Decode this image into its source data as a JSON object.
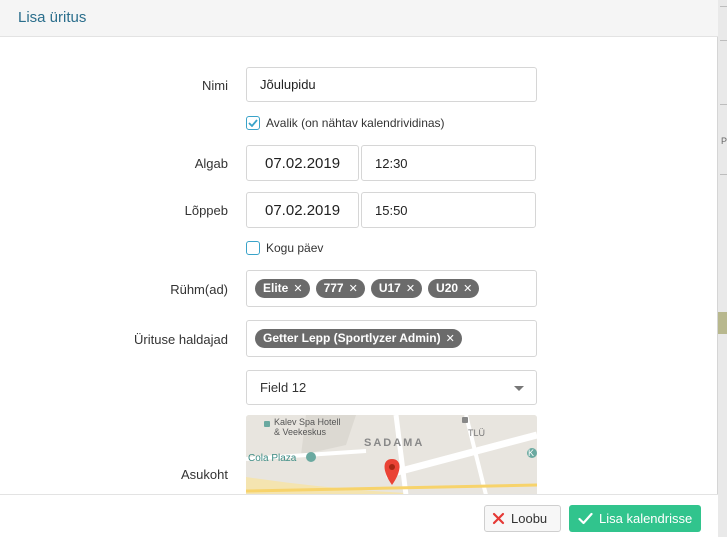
{
  "modal": {
    "title": "Lisa üritus"
  },
  "form": {
    "name_label": "Nimi",
    "name_value": "Jõulupidu",
    "public_label": "Avalik (on nähtav kalendrividinas)",
    "public_checked": true,
    "start_label": "Algab",
    "start_date": "07.02.2019",
    "start_time": "12:30",
    "end_label": "Lõppeb",
    "end_date": "07.02.2019",
    "end_time": "15:50",
    "allday_label": "Kogu päev",
    "allday_checked": false,
    "groups_label": "Rühm(ad)",
    "groups": [
      "Elite",
      "777",
      "U17",
      "U20"
    ],
    "managers_label": "Ürituse haldajad",
    "managers": [
      "Getter Lepp (Sportlyzer Admin)"
    ],
    "location_select": "Field 12",
    "location_label": "Asukoht",
    "map": {
      "labels": [
        "Kalev Spa Hotell",
        "& Veekeskus",
        "SADAMA",
        "TLÜ",
        "Cola Plaza",
        "K"
      ],
      "marker_color": "#ea4335"
    }
  },
  "footer": {
    "cancel_label": "Loobu",
    "save_label": "Lisa kalendrisse"
  },
  "colors": {
    "accent": "#3aa3c9",
    "title": "#2a6e8c",
    "primary_button": "#31c48d",
    "tag": "#6b6b6b",
    "cancel_icon": "#e53935"
  },
  "backdrop": {
    "edge_letter": "P"
  }
}
